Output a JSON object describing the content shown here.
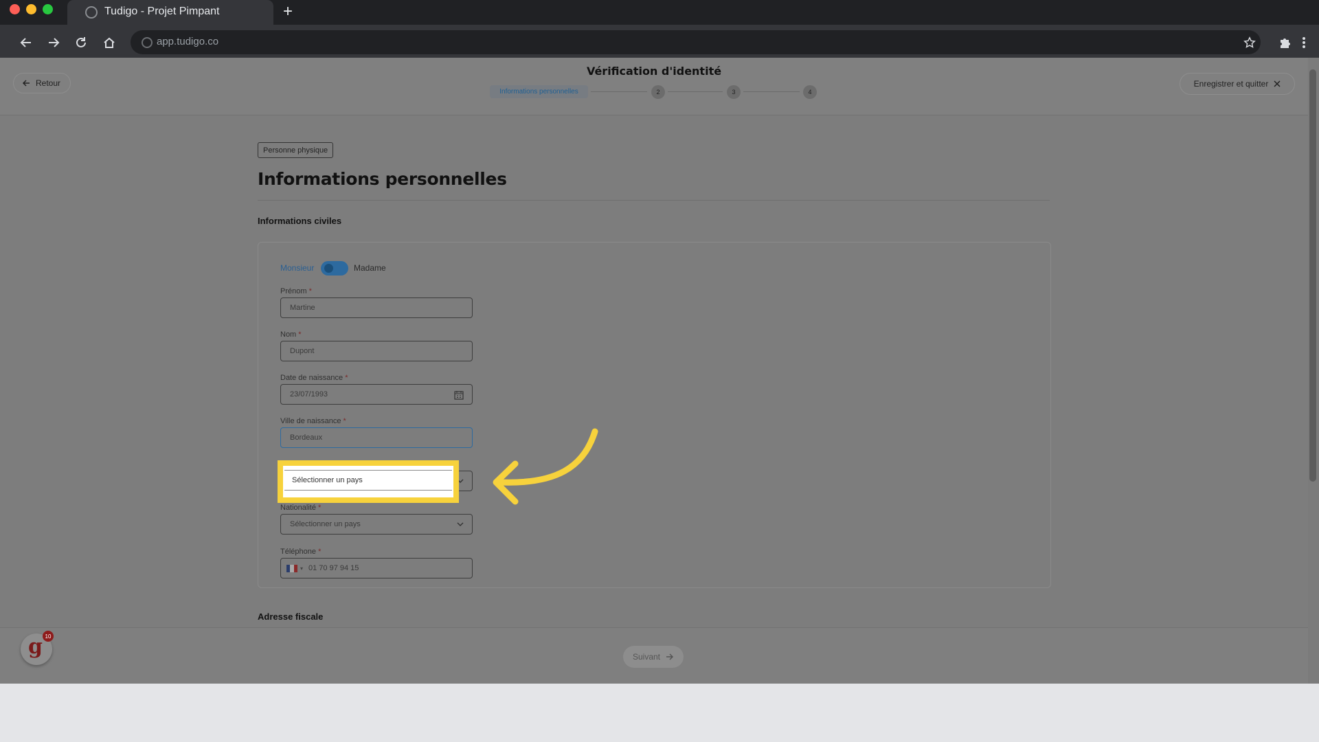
{
  "browser": {
    "tab_title": "Tudigo - Projet Pimpant",
    "url": "app.tudigo.co",
    "new_tab_label": "+"
  },
  "header": {
    "back_label": "Retour",
    "title": "Vérification d'identité",
    "save_quit_label": "Enregistrer et quitter",
    "steps": [
      "Informations personnelles",
      "2",
      "3",
      "4"
    ]
  },
  "main": {
    "badge": "Personne physique",
    "title": "Informations personnelles",
    "section_civil": "Informations civiles",
    "gender": {
      "left": "Monsieur",
      "right": "Madame"
    },
    "required_mark": "*",
    "fields": {
      "prenom": {
        "label": "Prénom",
        "value": "Martine"
      },
      "nom": {
        "label": "Nom",
        "value": "Dupont"
      },
      "date_naissance": {
        "label": "Date de naissance",
        "value": "23/07/1993"
      },
      "ville_naissance": {
        "label": "Ville de naissance",
        "value": "Bordeaux"
      },
      "pays_naissance": {
        "placeholder": "Sélectionner un pays"
      },
      "nationalite": {
        "label": "Nationalité",
        "placeholder": "Sélectionner un pays"
      },
      "telephone": {
        "label": "Téléphone",
        "value": "01 70 97 94 15"
      }
    },
    "section_address": "Adresse fiscale"
  },
  "footer": {
    "next_label": "Suivant",
    "widget_letter": "g",
    "widget_count": "10"
  },
  "colors": {
    "highlight": "#f7d23c",
    "toggle": "#2d6a9f",
    "overlay": "#7d7d7d"
  }
}
